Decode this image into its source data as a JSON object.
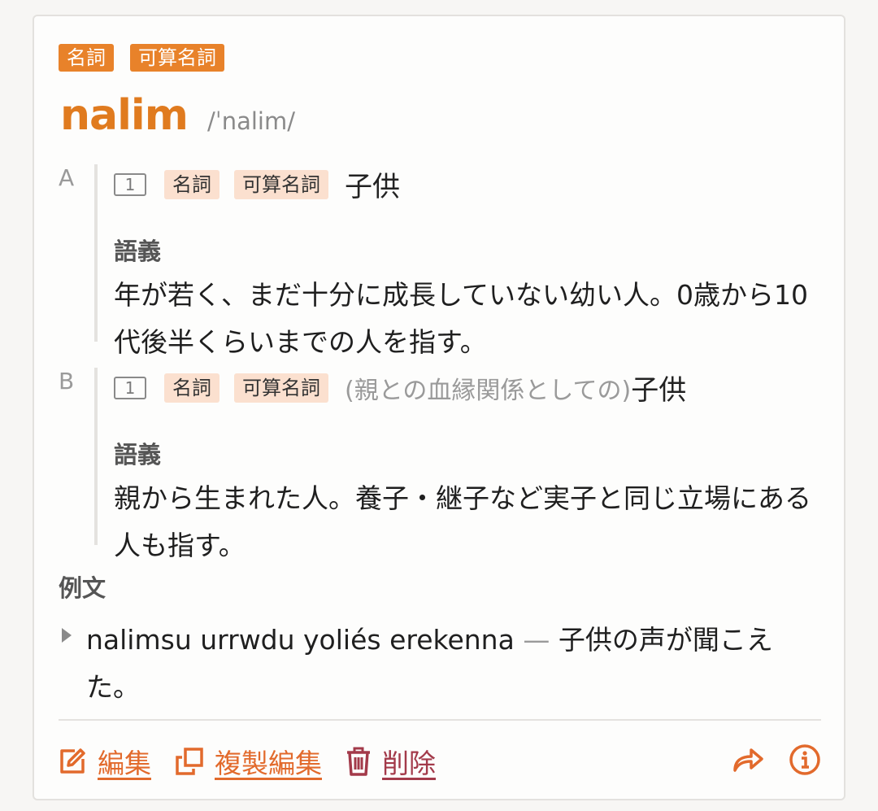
{
  "entry": {
    "tags": [
      "名詞",
      "可算名詞"
    ],
    "headword": "nalim",
    "pronunciation": "/ˈnalim/"
  },
  "senses": [
    {
      "letter": "A",
      "number": "1",
      "tags": [
        "名詞",
        "可算名詞"
      ],
      "qualifier": "",
      "gloss": "子供",
      "definition_label": "語義",
      "definition": "年が若く、まだ十分に成長していない幼い人。0歳から10代後半くらいまでの人を指す。"
    },
    {
      "letter": "B",
      "number": "1",
      "tags": [
        "名詞",
        "可算名詞"
      ],
      "qualifier": "(親との血縁関係としての)",
      "gloss": "子供",
      "definition_label": "語義",
      "definition": "親から生まれた人。養子・継子など実子と同じ立場にある人も指す。"
    }
  ],
  "examples": {
    "label": "例文",
    "items": [
      {
        "source": "nalimsu urrwdu yoliés erekenna",
        "separator": "—",
        "translation": "子供の声が聞こえた。"
      }
    ]
  },
  "actions": {
    "edit": "編集",
    "duplicate_edit": "複製編集",
    "delete": "削除",
    "share_icon": "share-icon",
    "info_icon": "info-icon"
  },
  "colors": {
    "accent": "#e07b1f",
    "tag_bg": "#fbe0cf",
    "delete": "#a33a4a"
  }
}
